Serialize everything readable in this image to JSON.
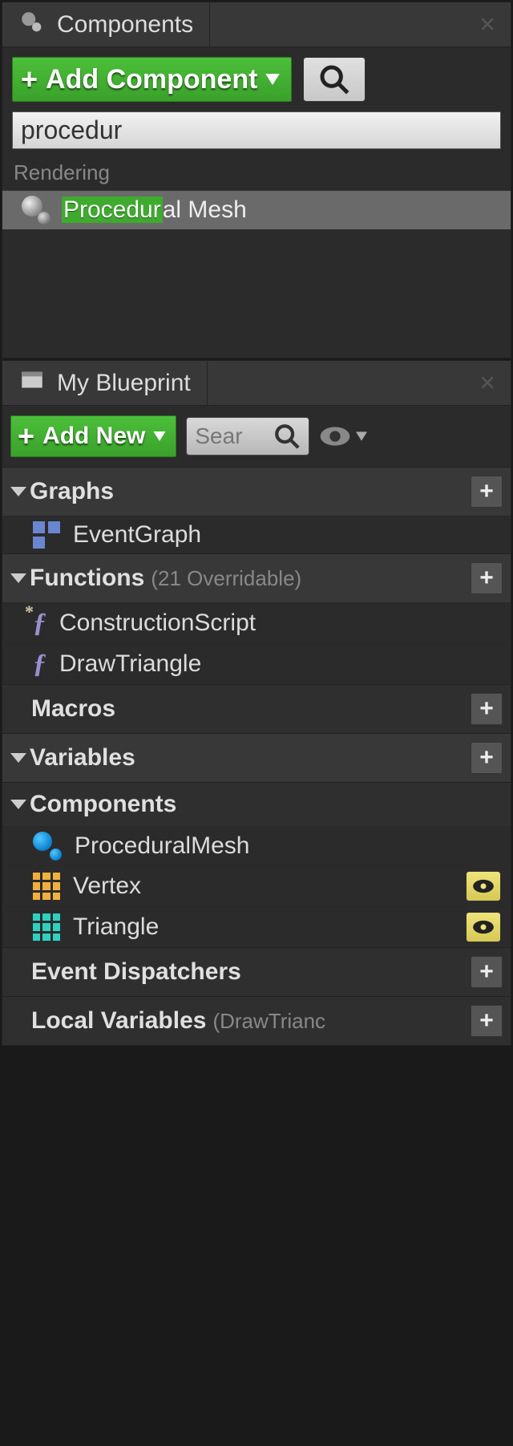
{
  "colors": {
    "accent_green": "#3eab2e",
    "bg": "#2b2b2b"
  },
  "components_panel": {
    "title": "Components",
    "add_button": "Add Component",
    "search_value": "procedur",
    "category": "Rendering",
    "result_highlight": "Procedur",
    "result_rest": "al Mesh"
  },
  "my_blueprint_panel": {
    "title": "My Blueprint",
    "add_button": "Add New",
    "search_placeholder": "Sear",
    "sections": {
      "graphs": {
        "label": "Graphs",
        "items": [
          "EventGraph"
        ]
      },
      "functions": {
        "label": "Functions",
        "count": "(21 Overridable)",
        "items": [
          "ConstructionScript",
          "DrawTriangle"
        ]
      },
      "macros": {
        "label": "Macros"
      },
      "variables": {
        "label": "Variables"
      },
      "components": {
        "label": "Components",
        "items": [
          "ProceduralMesh",
          "Vertex",
          "Triangle"
        ]
      },
      "event_dispatchers": {
        "label": "Event Dispatchers"
      },
      "local_variables": {
        "label": "Local Variables",
        "context": "(DrawTrianc"
      }
    }
  }
}
